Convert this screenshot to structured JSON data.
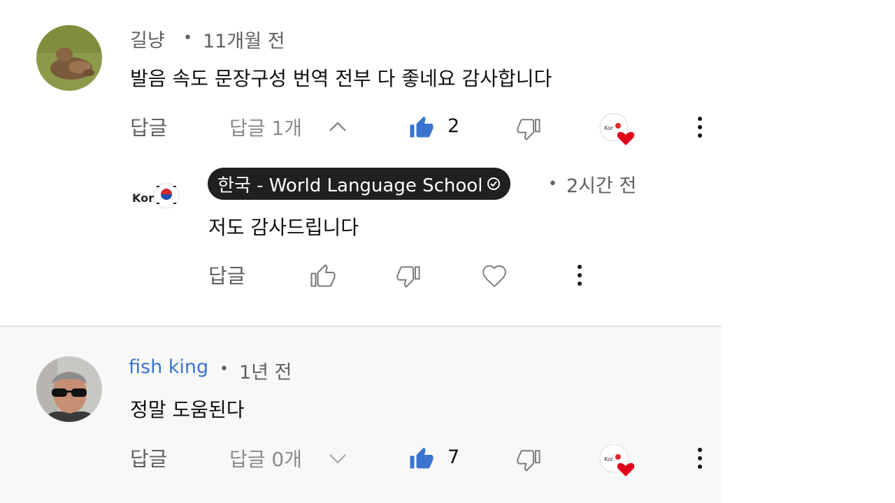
{
  "comments": [
    {
      "author": "길냥",
      "time": "11개월 전",
      "text": "발음 속도 문장구성 번역 전부 다 좋네요 감사합니다",
      "reply_label": "답글",
      "replies_label": "답글 1개",
      "likes": "2",
      "liked": true,
      "expanded": true,
      "reply": {
        "author": "한국 - World Language School",
        "time": "2시간 전",
        "text": "저도 감사드립니다",
        "reply_label": "답글",
        "avatar_text": "Kor"
      }
    },
    {
      "author": "fish king",
      "time": "1년 전",
      "text": "정말 도움된다",
      "reply_label": "답글",
      "replies_label": "답글 0개",
      "likes": "7",
      "liked": true,
      "expanded": false
    }
  ],
  "colors": {
    "like_blue": "#3a74cf",
    "heart_red": "#e0001b",
    "owner_badge_bg": "#202020",
    "author_link_blue": "#3a74cf"
  },
  "icons": [
    "thumb-up-icon",
    "thumb-down-icon",
    "heart-icon",
    "more-vert-icon",
    "chevron-up-icon",
    "chevron-down-icon",
    "verified-check-icon"
  ]
}
